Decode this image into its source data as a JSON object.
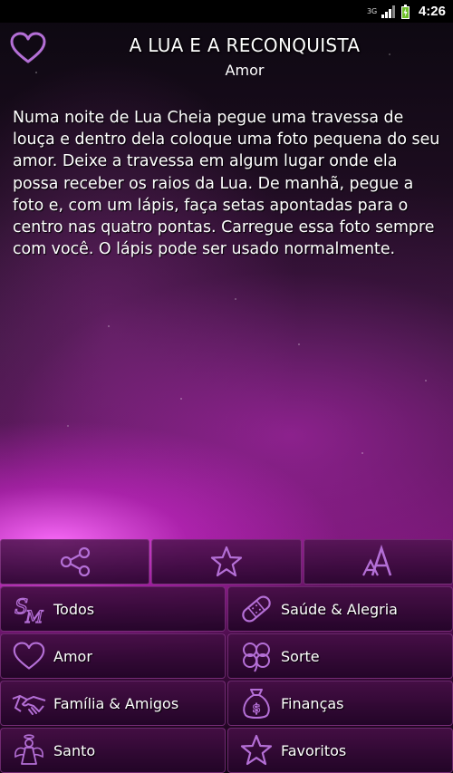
{
  "status_bar": {
    "network": "3G",
    "time": "4:26"
  },
  "header": {
    "title": "A LUA E A RECONQUISTA",
    "subtitle": "Amor",
    "icon": "heart-icon"
  },
  "content": {
    "text": "Numa noite de Lua Cheia pegue uma travessa de louça e dentro dela coloque uma foto pequena do seu amor. Deixe a travessa em algum lugar onde ela possa receber os raios da Lua. De manhã, pegue a foto e, com um lápis, faça setas apontadas para o centro nas quatro pontas. Carregue essa foto sempre com você. O lápis pode ser usado normalmente."
  },
  "actions": [
    {
      "icon": "share-icon"
    },
    {
      "icon": "star-icon"
    },
    {
      "icon": "font-size-icon"
    }
  ],
  "categories": [
    {
      "label": "Todos",
      "icon": "sm-monogram-icon",
      "logo_text": "SM"
    },
    {
      "label": "Saúde & Alegria",
      "icon": "bandage-icon"
    },
    {
      "label": "Amor",
      "icon": "heart-icon"
    },
    {
      "label": "Sorte",
      "icon": "clover-icon"
    },
    {
      "label": "Família & Amigos",
      "icon": "handshake-icon"
    },
    {
      "label": "Finanças",
      "icon": "money-bag-icon"
    },
    {
      "label": "Santo",
      "icon": "angel-icon"
    },
    {
      "label": "Favoritos",
      "icon": "star-icon"
    }
  ],
  "colors": {
    "accent": "#c77fe0",
    "icon_stroke": "#b46fd6"
  }
}
